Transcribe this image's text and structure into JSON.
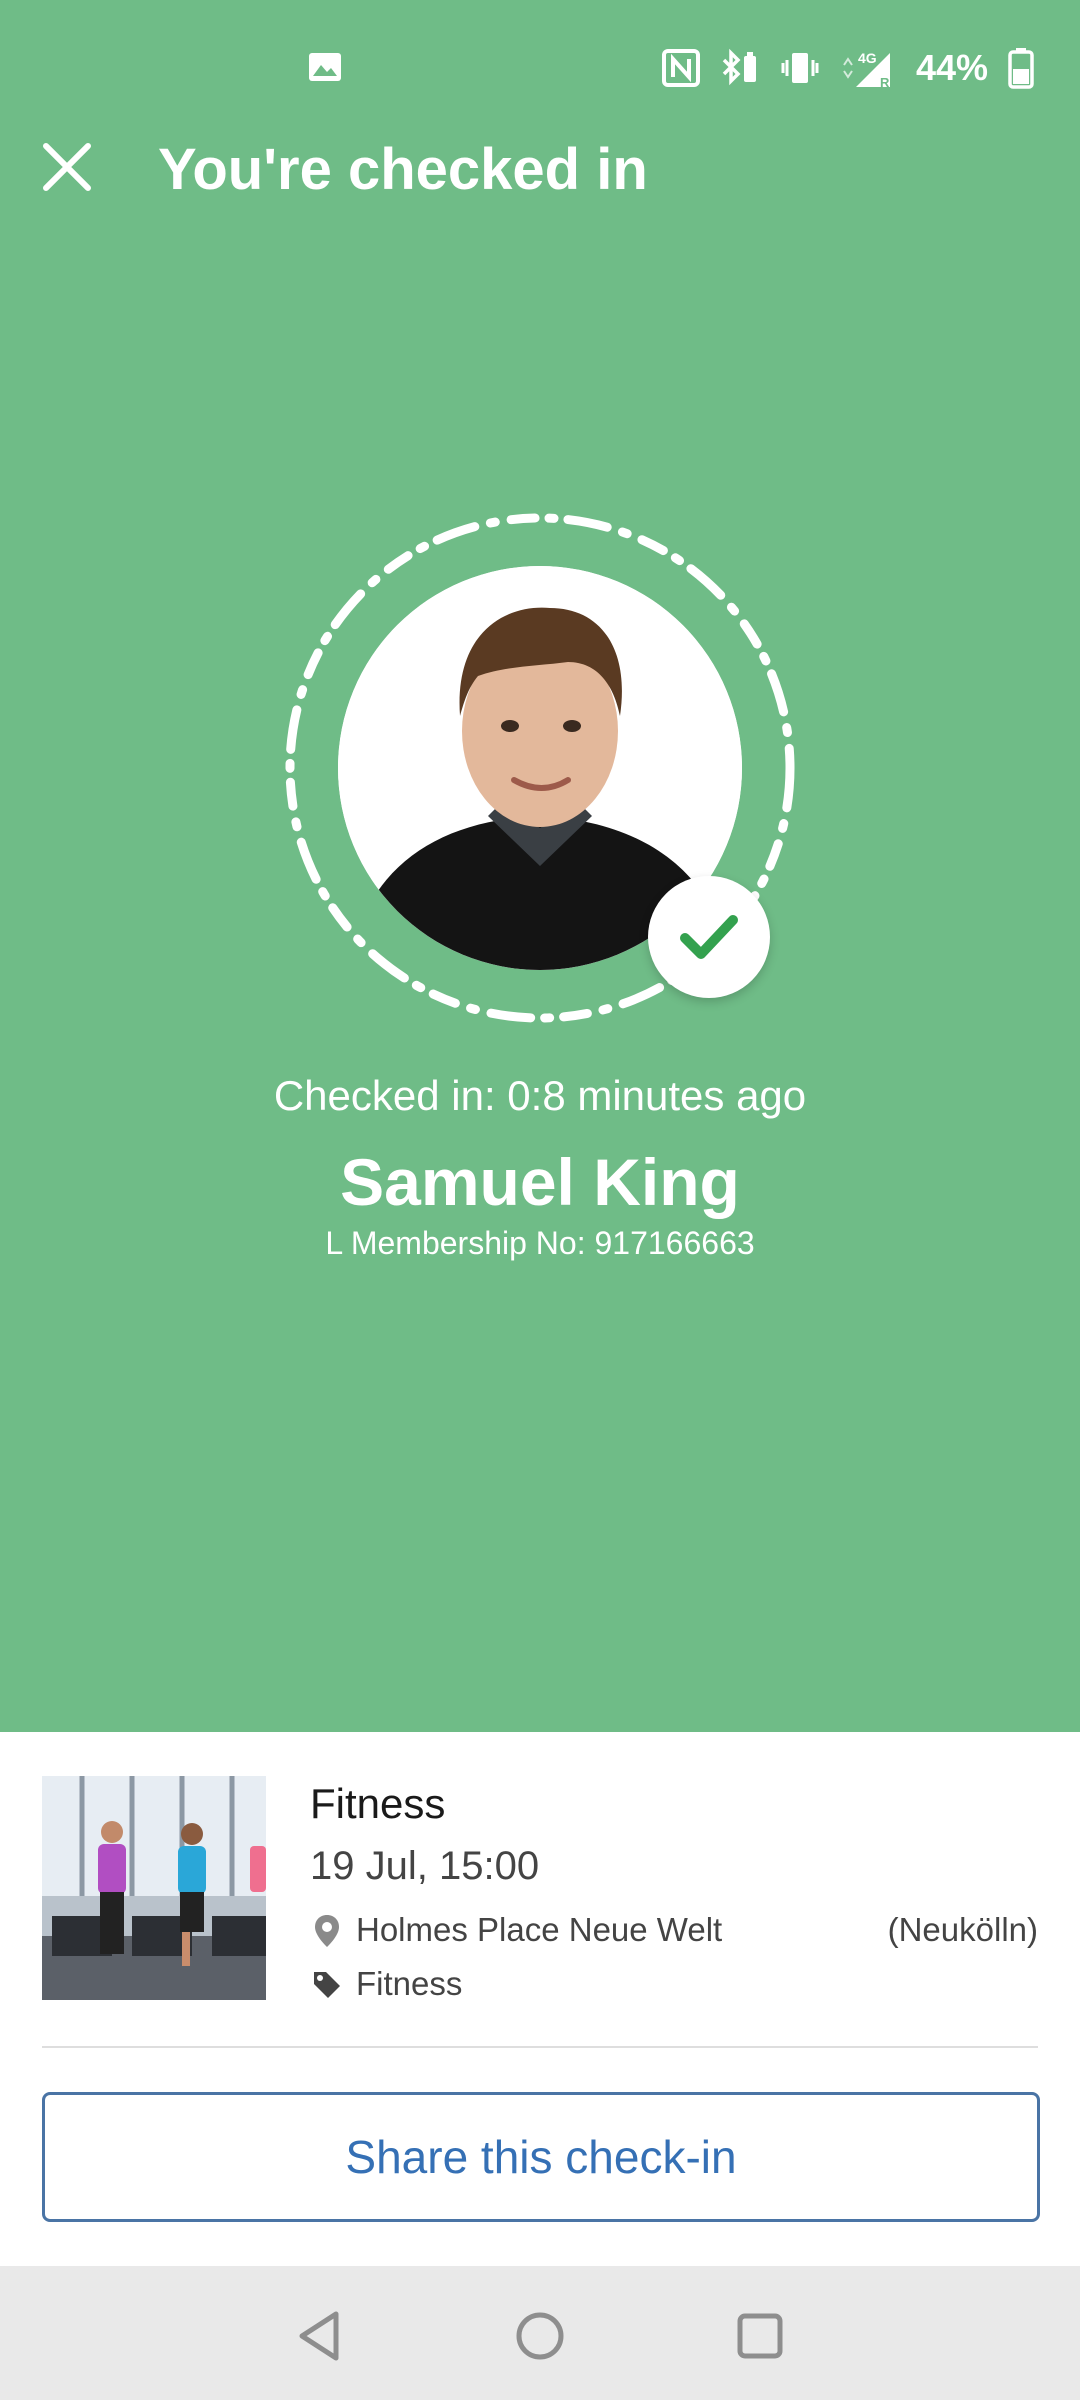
{
  "colors": {
    "header_green": "#6fbc87",
    "accent_blue": "#3570b5",
    "check_green": "#33a14e"
  },
  "status_bar": {
    "icons": [
      "gallery-icon",
      "nfc-icon",
      "bluetooth-battery-icon",
      "vibrate-icon",
      "signal-4g-icon",
      "battery-icon"
    ],
    "network_label": "4G",
    "roaming_label": "R",
    "battery_percent": "44%"
  },
  "header": {
    "close_icon": "close-icon",
    "title": "You're checked in"
  },
  "checkin": {
    "status_icon": "checkmark-icon",
    "time_text": "Checked in: 0:8 minutes ago",
    "member_name": "Samuel King",
    "membership_text": "L Membership No: 917166663"
  },
  "class_card": {
    "name": "Fitness",
    "date": "19 Jul, 15:00",
    "location_icon": "location-pin-icon",
    "location": "Holmes Place Neue Welt",
    "location_area": "(Neukölln)",
    "tag_icon": "tag-icon",
    "category": "Fitness"
  },
  "actions": {
    "share_label": "Share this check-in"
  },
  "nav_bar": {
    "buttons": [
      "back-icon",
      "home-icon",
      "recents-icon"
    ]
  }
}
